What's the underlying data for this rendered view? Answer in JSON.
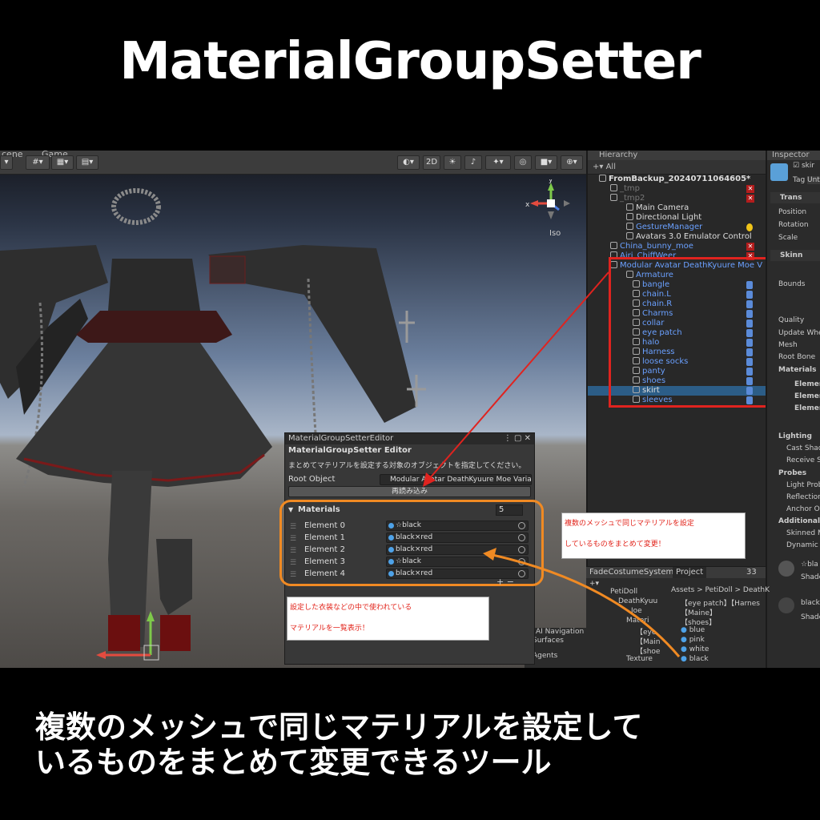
{
  "title": "MaterialGroupSetter",
  "caption": [
    "複数のメッシュで同じマテリアルを設定して",
    "いるものをまとめて変更できるツール"
  ],
  "scene": {
    "tab_left": "cene",
    "tab_game": "Game",
    "toolbar_2d": "2D",
    "iso_label": "Iso",
    "gizmo_x": "x",
    "gizmo_y": "y"
  },
  "hierarchy": {
    "header": "Hierarchy",
    "search": "All",
    "rows": [
      {
        "label": "FromBackup_20240711064605*",
        "indent": 14,
        "style": "scene-root"
      },
      {
        "label": "_tmp",
        "indent": 28,
        "style": "dim",
        "badge": "x"
      },
      {
        "label": "_tmp2",
        "indent": 28,
        "style": "dim",
        "badge": "x"
      },
      {
        "label": "Main Camera",
        "indent": 48,
        "style": ""
      },
      {
        "label": "Directional Light",
        "indent": 48,
        "style": ""
      },
      {
        "label": "GestureManager",
        "indent": 48,
        "style": "blue",
        "badge": "light"
      },
      {
        "label": "Avatars 3.0 Emulator Control",
        "indent": 48,
        "style": ""
      },
      {
        "label": "China_bunny_moe",
        "indent": 28,
        "style": "blue",
        "badge": "x"
      },
      {
        "label": "Airi_ChiffWeer",
        "indent": 28,
        "style": "blue",
        "badge": "x"
      },
      {
        "label": "Modular Avatar DeathKyuure Moe V",
        "indent": 28,
        "style": "blue"
      },
      {
        "label": "Armature",
        "indent": 48,
        "style": "blue"
      },
      {
        "label": "bangle",
        "indent": 56,
        "style": "blue",
        "badge": "pin"
      },
      {
        "label": "chain.L",
        "indent": 56,
        "style": "blue",
        "badge": "pin"
      },
      {
        "label": "chain.R",
        "indent": 56,
        "style": "blue",
        "badge": "pin"
      },
      {
        "label": "Charms",
        "indent": 56,
        "style": "blue",
        "badge": "pin"
      },
      {
        "label": "collar",
        "indent": 56,
        "style": "blue",
        "badge": "pin"
      },
      {
        "label": "eye patch",
        "indent": 56,
        "style": "blue",
        "badge": "pin"
      },
      {
        "label": "halo",
        "indent": 56,
        "style": "blue",
        "badge": "pin"
      },
      {
        "label": "Harness",
        "indent": 56,
        "style": "blue",
        "badge": "pin"
      },
      {
        "label": "loose socks",
        "indent": 56,
        "style": "blue",
        "badge": "pin"
      },
      {
        "label": "panty",
        "indent": 56,
        "style": "blue",
        "badge": "pin"
      },
      {
        "label": "shoes",
        "indent": 56,
        "style": "blue",
        "badge": "pin"
      },
      {
        "label": "skirt",
        "indent": 56,
        "style": "sel",
        "badge": "pin"
      },
      {
        "label": "sleeves",
        "indent": 56,
        "style": "blue",
        "badge": "pin"
      }
    ]
  },
  "inspector": {
    "header": "Inspector",
    "name": "skir",
    "tag_label": "Tag",
    "tag_value": "Unt",
    "transform": "Trans",
    "position": "Position",
    "rotation": "Rotation",
    "scale": "Scale",
    "skinned": "Skinn",
    "bounds": "Bounds",
    "quality": "Quality",
    "update_when": "Update Whe",
    "mesh": "Mesh",
    "root_bone": "Root Bone",
    "materials": "Materials",
    "elements": [
      "Elemer",
      "Elemer",
      "Elemer"
    ],
    "lighting": "Lighting",
    "cast_shadows": "Cast Shad",
    "receive": "Receive S",
    "probes": "Probes",
    "light_probes": "Light Prob",
    "reflection": "Reflection",
    "anchor": "Anchor Ov",
    "additional": "Additional S",
    "skinned_motion": "Skinned M",
    "dynamic": "Dynamic",
    "mat1_name": "☆bla",
    "mat1_shader": "Shade",
    "mat2_name": "black",
    "mat2_shader": "Shade"
  },
  "editor": {
    "tab": "MaterialGroupSetterEditor",
    "title": "MaterialGroupSetter Editor",
    "description": "まとめてマテリアルを設定する対象のオブジェクトを指定してください。",
    "root_label": "Root Object",
    "root_value": "Modular Avatar DeathKyuure Moe Varia",
    "reload_button": "再読み込み",
    "materials_label": "Materials",
    "materials_count": "5",
    "elements": [
      {
        "label": "Element 0",
        "value": "☆black"
      },
      {
        "label": "Element 1",
        "value": "black×red"
      },
      {
        "label": "Element 2",
        "value": "black×red"
      },
      {
        "label": "Element 3",
        "value": "☆black"
      },
      {
        "label": "Element 4",
        "value": "black×red"
      }
    ],
    "plus_minus": "+  −"
  },
  "notes": {
    "right": [
      "複数のメッシュで同じマテリアルを設定",
      "しているものをまとめて変更！"
    ],
    "left": [
      "設定した衣装などの中で使われている",
      "マテリアルを一覧表示！"
    ]
  },
  "lower": {
    "tab1": "FadeCostumeSystem",
    "tab2": "Project",
    "count": "33",
    "breadcrumb": "Assets > PetiDoll > DeathK",
    "tree": [
      "PetiDoll",
      "DeathKyuu",
      "Joe",
      "Materi",
      "【eye",
      "【Main",
      "【shoe",
      "Texture"
    ],
    "files": [
      "【eye patch】【Harnes",
      "【Maine】",
      "【shoes】",
      "blue",
      "pink",
      "white",
      "black"
    ]
  },
  "ai_panel": {
    "header": "AI Navigation",
    "surfaces": "Surfaces",
    "agents": "Agents"
  },
  "colors": {
    "red_highlight": "#e0231f",
    "orange_highlight": "#f08a23",
    "unity_blue": "#6aa0ff",
    "selection": "#2c5d87"
  }
}
